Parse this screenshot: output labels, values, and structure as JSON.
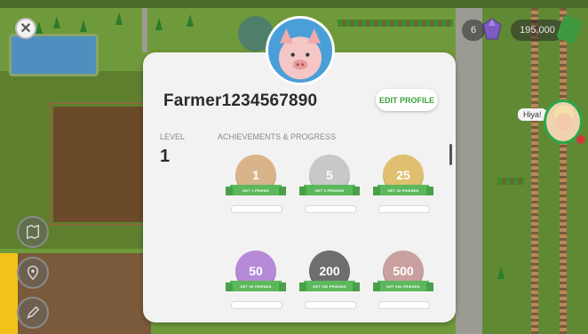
{
  "hud": {
    "close_icon": "close-icon",
    "gem_count": "6",
    "coin_balance": "195,000",
    "npc_chat": "Hiya!",
    "side_buttons": [
      "map-icon",
      "location-pin-icon",
      "pencil-icon"
    ]
  },
  "profile": {
    "username": "Farmer1234567890",
    "edit_button": "EDIT PROFILE",
    "level_label": "LEVEL",
    "level_value": "1",
    "achievements_label": "ACHIEVEMENTS & PROGRESS"
  },
  "achievements": [
    {
      "value": "1",
      "ribbon": "GET 1 FRIEND",
      "color": "#d9b48a"
    },
    {
      "value": "5",
      "ribbon": "GET 5 FRIENDS",
      "color": "#c8c8c8"
    },
    {
      "value": "25",
      "ribbon": "GET 25 FRIENDS",
      "color": "#e0c070"
    },
    {
      "value": "50",
      "ribbon": "GET 50 FRIENDS",
      "color": "#b58ad6"
    },
    {
      "value": "200",
      "ribbon": "GET 200 FRIENDS",
      "color": "#6e6e6e"
    },
    {
      "value": "500",
      "ribbon": "GET 500 FRIENDS",
      "color": "#c9a0a0"
    }
  ],
  "colors": {
    "accent_green": "#3aa13a",
    "panel_bg": "#f2f2f2"
  }
}
